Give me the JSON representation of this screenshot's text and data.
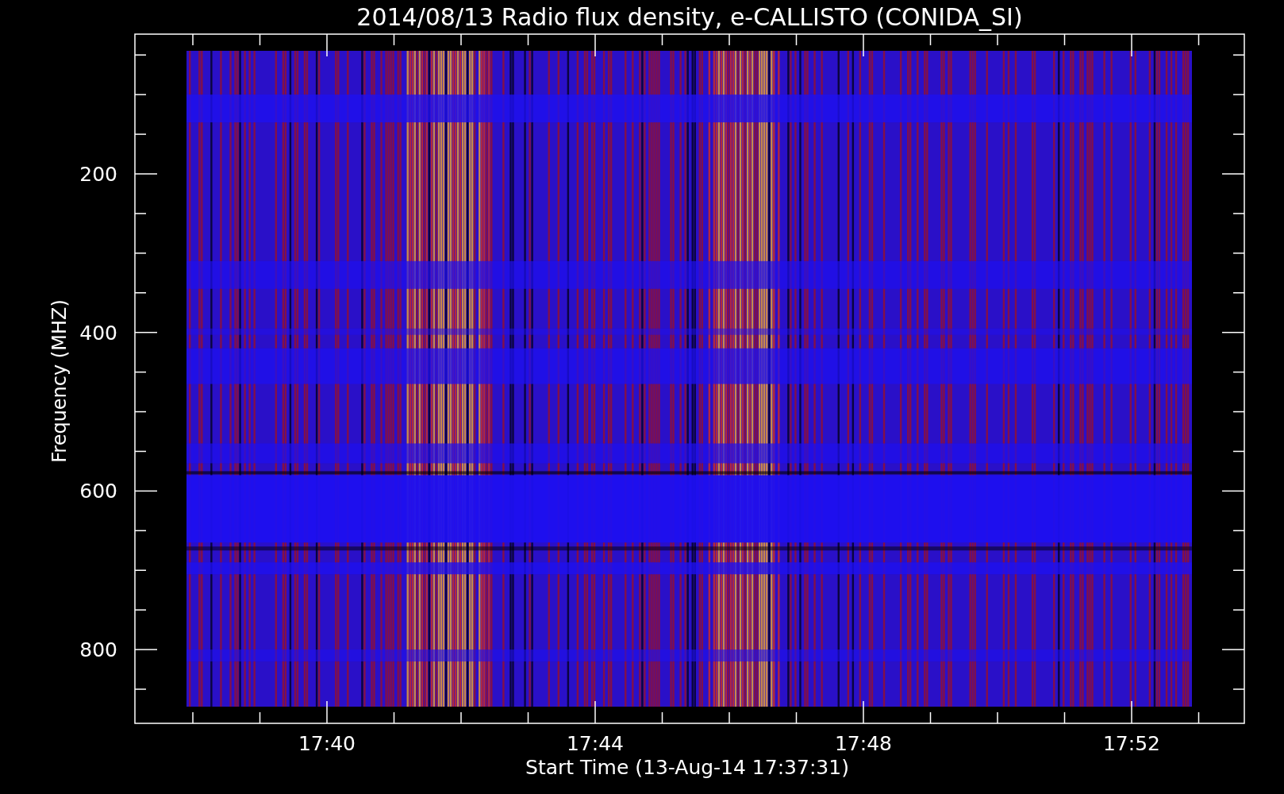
{
  "title": "2014/08/13  Radio flux density, e-CALLISTO (CONIDA_SI)",
  "y_axis": {
    "label": "Frequency (MHZ)",
    "ticks": [
      "200",
      "400",
      "600",
      "800"
    ]
  },
  "x_axis": {
    "label": "Start Time (13-Aug-14 17:37:31)",
    "ticks": [
      "17:40",
      "17:44",
      "17:48",
      "17:52"
    ]
  }
}
